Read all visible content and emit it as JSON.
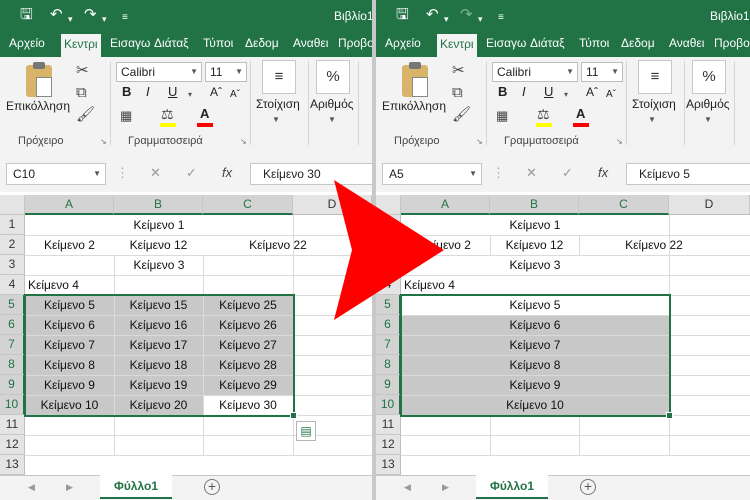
{
  "ribbon_tabs": [
    "Αρχείο",
    "Κεντρι",
    "Εισαγω",
    "Διάταξ",
    "Τύποι",
    "Δεδομ",
    "Αναθει",
    "Προβο"
  ],
  "ribbon_tabs_right": [
    "Αρχείο",
    "Κεντρι",
    "Εισαγω",
    "Διάταξ",
    "Τύποι",
    "Δεδομ",
    "Αναθει",
    "Προβο"
  ],
  "title": "Βιβλίο1",
  "ribbon": {
    "paste": "Επικόλληση",
    "clipboard": "Πρόχειρο",
    "font_name": "Calibri",
    "font_size": "11",
    "font_group": "Γραμματοσειρά",
    "alignment": "Στοίχιση",
    "number": "Αριθμός",
    "percent": "%",
    "bold": "B",
    "italic": "I",
    "underline": "U",
    "font_color": "A",
    "fx": "fx"
  },
  "left": {
    "name_box": "C10",
    "formula": "Κείμενο 30",
    "cells": {
      "r1": "Κείμενο 1",
      "r2a": "Κείμενο 2",
      "r2b": "Κείμενο 12",
      "r2c": "Κείμενο 22",
      "r3": "Κείμενο 3",
      "r4": "Κείμενο 4",
      "colA": [
        "Κείμενο 5",
        "Κείμενο 6",
        "Κείμενο 7",
        "Κείμενο 8",
        "Κείμενο 9",
        "Κείμενο 10"
      ],
      "colB": [
        "Κείμενο 15",
        "Κείμενο 16",
        "Κείμενο 17",
        "Κείμενο 18",
        "Κείμενο 19",
        "Κείμενο 20"
      ],
      "colC": [
        "Κείμενο 25",
        "Κείμενο 26",
        "Κείμενο 27",
        "Κείμενο 28",
        "Κείμενο 29",
        "Κείμενο 30"
      ]
    }
  },
  "right": {
    "name_box": "A5",
    "formula": "Κείμενο 5",
    "cells": {
      "r1": "Κείμενο 1",
      "r2a": "Κείμενο 2",
      "r2b": "Κείμενο 12",
      "r2c": "Κείμενο 22",
      "r3": "Κείμενο 3",
      "r4": "Κείμενο 4",
      "merged": [
        "Κείμενο 5",
        "Κείμενο 6",
        "Κείμενο 7",
        "Κείμενο 8",
        "Κείμενο 9",
        "Κείμενο 10"
      ]
    }
  },
  "columns": [
    "A",
    "B",
    "C",
    "D"
  ],
  "rows": [
    "1",
    "2",
    "3",
    "4",
    "5",
    "6",
    "7",
    "8",
    "9",
    "10",
    "11",
    "12",
    "13"
  ],
  "sheet_tab": "Φύλλο1",
  "add_sheet": "+",
  "colors": {
    "excel_green": "#217346",
    "arrow_red": "#ff0000",
    "selection_gray": "#c8c8c8"
  }
}
